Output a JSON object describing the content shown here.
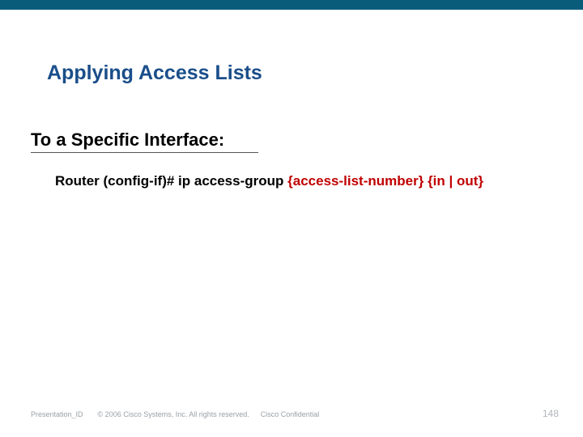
{
  "title": "Applying Access Lists",
  "subtitle": "To a Specific Interface:",
  "command": {
    "prefix": "Router (config-if)# ip access-group ",
    "arg1": "{access-list-number}",
    "sep": "  ",
    "arg2": "{in | out}"
  },
  "footer": {
    "presentation_id": "Presentation_ID",
    "copyright": "© 2006 Cisco Systems, Inc. All rights reserved.",
    "confidential": "Cisco Confidential",
    "page": "148"
  }
}
